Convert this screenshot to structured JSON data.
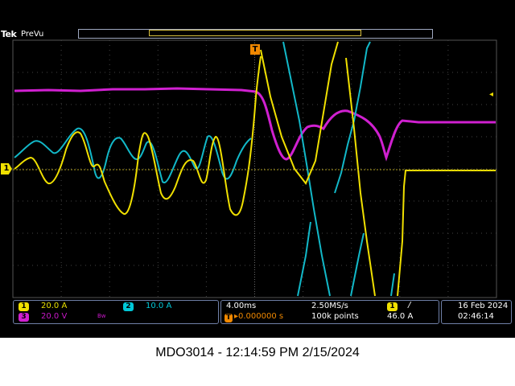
{
  "header": {
    "brand": "Tek",
    "mode": "PreVu"
  },
  "trigger": {
    "time_marker": "T",
    "level_marker": "◂"
  },
  "channels": {
    "ch1": {
      "num": "1",
      "scale": "20.0 A",
      "color": "#f0e000"
    },
    "ch2": {
      "num": "2",
      "scale": "10.0 A",
      "color": "#00c8d8"
    },
    "ch3": {
      "num": "3",
      "scale": "20.0 V",
      "color": "#d020d0",
      "suffix": "Bw"
    }
  },
  "timebase": {
    "per_div": "4.00ms",
    "rate": "2.50MS/s",
    "delay": "▸0.000000 s",
    "points": "100k points"
  },
  "trigger_readout": {
    "source": "1",
    "slope": "/",
    "level": "46.0 A"
  },
  "datetime": {
    "date": "16 Feb 2024",
    "time": "02:46:14"
  },
  "caption": "MDO3014 - 12:14:59 PM   2/15/2024"
}
